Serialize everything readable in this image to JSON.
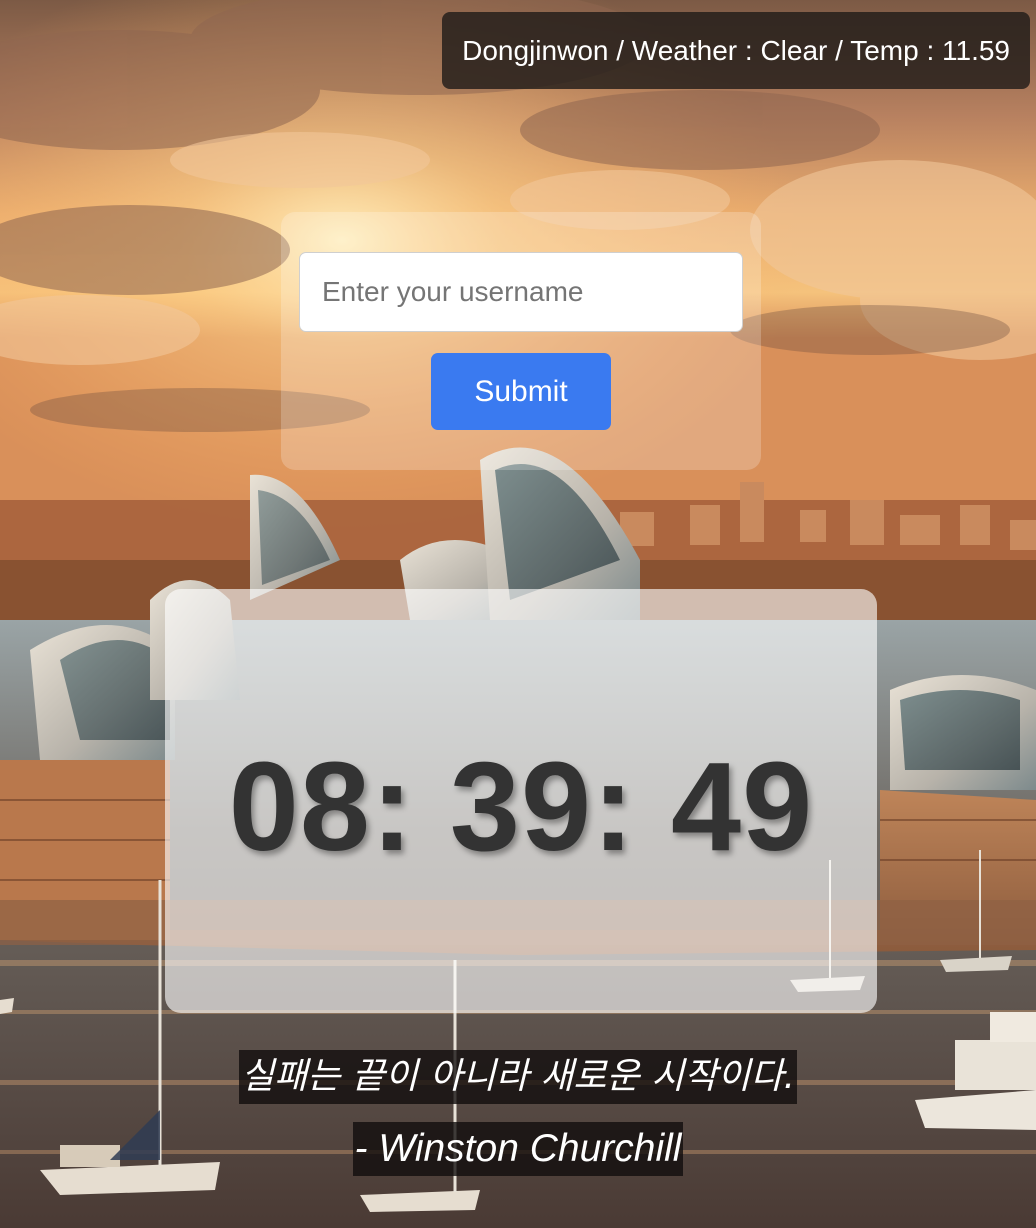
{
  "weather": {
    "text": "Dongjinwon / Weather : Clear / Temp : 11.59"
  },
  "login": {
    "username_placeholder": "Enter your username",
    "username_value": "",
    "submit_label": "Submit"
  },
  "clock": {
    "time": "08: 39: 49"
  },
  "quote": {
    "text": "실패는 끝이 아니라 새로운 시작이다.",
    "author": "- Winston Churchill"
  },
  "colors": {
    "submit_button": "#3a7af0",
    "weather_badge_bg": "#1e1a18",
    "clock_text": "#333333"
  }
}
